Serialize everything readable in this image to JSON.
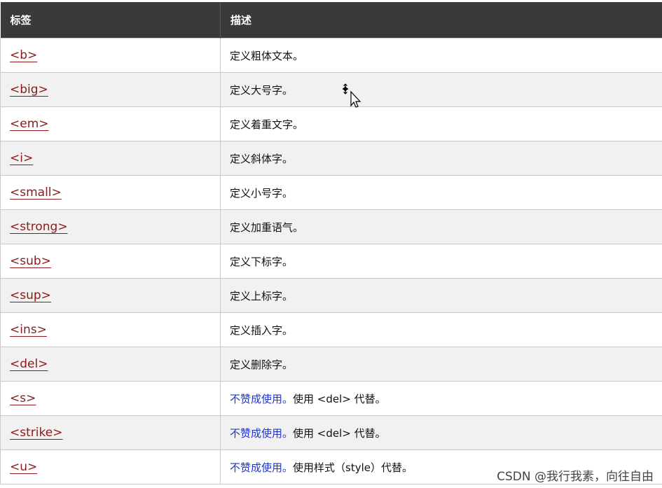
{
  "header": {
    "col_tag": "标签",
    "col_desc": "描述"
  },
  "rows": [
    {
      "tag": "<b>",
      "desc": "定义粗体文本。"
    },
    {
      "tag": "<big>",
      "desc": "定义大号字。"
    },
    {
      "tag": "<em>",
      "desc": "定义着重文字。"
    },
    {
      "tag": "<i>",
      "desc": "定义斜体字。"
    },
    {
      "tag": "<small>",
      "desc": "定义小号字。"
    },
    {
      "tag": "<strong>",
      "desc": "定义加重语气。"
    },
    {
      "tag": "<sub>",
      "desc": "定义下标字。"
    },
    {
      "tag": "<sup>",
      "desc": "定义上标字。"
    },
    {
      "tag": "<ins>",
      "desc": "定义插入字。"
    },
    {
      "tag": "<del>",
      "desc": "定义删除字。"
    },
    {
      "tag": "<s>",
      "deprecated": "不赞成使用。",
      "desc": "使用 <del> 代替。"
    },
    {
      "tag": "<strike>",
      "deprecated": "不赞成使用。",
      "desc": "使用 <del> 代替。"
    },
    {
      "tag": "<u>",
      "deprecated": "不赞成使用。",
      "desc": "使用样式（style）代替。"
    }
  ],
  "watermark": "CSDN @我行我素，向往自由",
  "colors": {
    "header_bg": "#3a3a3a",
    "link": "#8b1a1a",
    "deprecated": "#2136c9",
    "row_alt": "#f1f1f1"
  },
  "icons": {
    "cursor": "move-cursor-icon"
  }
}
